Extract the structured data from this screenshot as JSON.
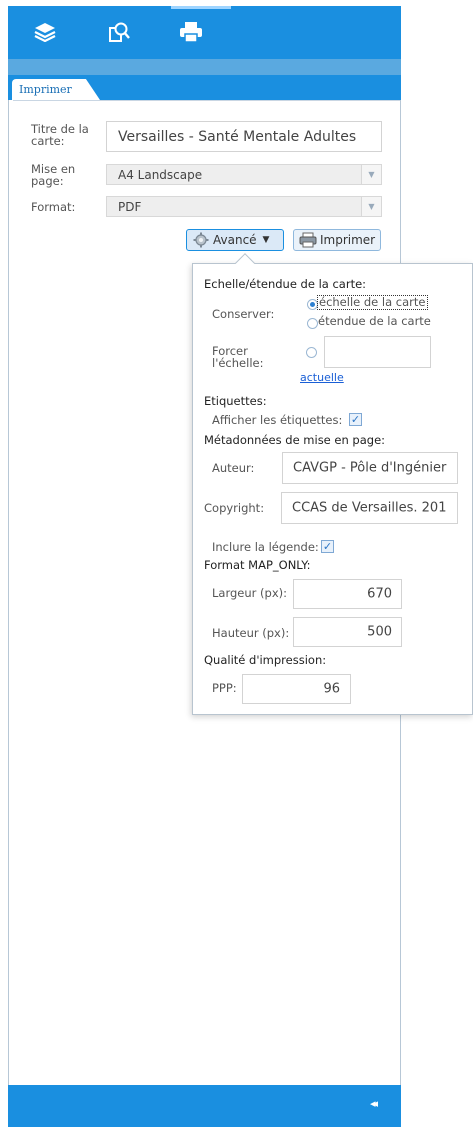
{
  "toolbar": {
    "tools": [
      {
        "name": "layers-icon"
      },
      {
        "name": "query-icon"
      },
      {
        "name": "print-icon",
        "active": true
      }
    ]
  },
  "tab": {
    "label": "Imprimer"
  },
  "form": {
    "title_label": "Titre de la carte:",
    "title_value": "Versailles - Santé Mentale Adultes",
    "layout_label": "Mise en page:",
    "layout_value": "A4 Landscape",
    "format_label": "Format:",
    "format_value": "PDF",
    "advanced_button": "Avancé",
    "print_button": "Imprimer"
  },
  "advanced": {
    "scale_heading": "Echelle/étendue de la carte:",
    "preserve_label": "Conserver:",
    "preserve_options": [
      "échelle de la carte",
      "étendue de la carte"
    ],
    "preserve_selected": "échelle de la carte",
    "force_scale_label": "Forcer l'échelle:",
    "force_scale_value": "",
    "current_link": "actuelle",
    "labels_heading": "Etiquettes:",
    "show_labels_label": "Afficher les étiquettes:",
    "show_labels_checked": true,
    "metadata_heading": "Métadonnées de mise en page:",
    "author_label": "Auteur:",
    "author_value": "CAVGP - Pôle d'Ingénier",
    "copyright_label": "Copyright:",
    "copyright_value": "CCAS de Versailles. 201",
    "legend_label": "Inclure la légende:",
    "legend_checked": true,
    "maponly_heading": "Format MAP_ONLY:",
    "width_label": "Largeur (px):",
    "width_value": "670",
    "height_label": "Hauteur (px):",
    "height_value": "500",
    "quality_heading": "Qualité d'impression:",
    "dpi_label": "PPP:",
    "dpi_value": "96"
  },
  "bottom": {
    "collapse_glyph": "◂◂"
  },
  "colors": {
    "accent": "#1a8fe0",
    "link": "#1a5fd6"
  }
}
